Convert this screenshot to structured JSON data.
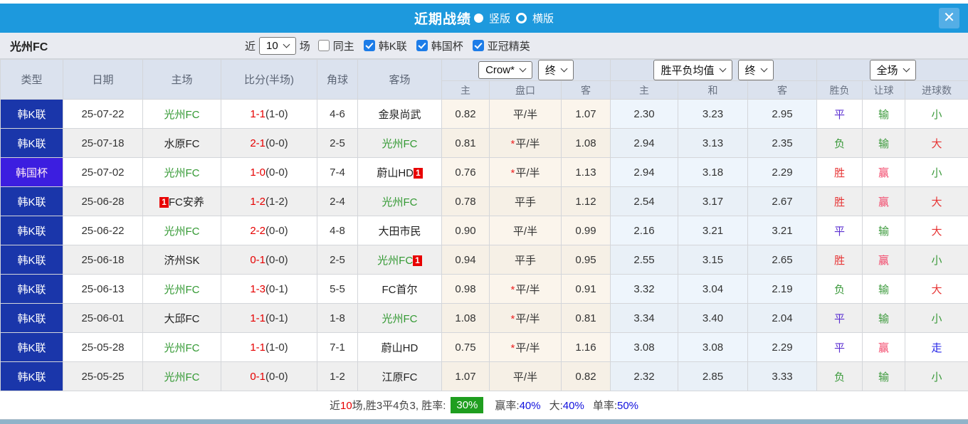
{
  "title_bar": {
    "title": "近期战绩",
    "vertical_label": "竖版",
    "horizontal_label": "横版",
    "close_glyph": "✕"
  },
  "filter_bar": {
    "team": "光州FC",
    "near_label": "近",
    "count_value": "10",
    "games_label": "场",
    "same_home_label": "同主",
    "leagues": [
      "韩K联",
      "韩国杯",
      "亚冠精英"
    ]
  },
  "table": {
    "headers_main": [
      "类型",
      "日期",
      "主场",
      "比分(半场)",
      "角球",
      "客场"
    ],
    "sub": [
      "主",
      "盘口",
      "客",
      "主",
      "和",
      "客",
      "胜负",
      "让球",
      "进球数"
    ],
    "dropdowns": {
      "asia_company": "Crow*",
      "asia_time": "终",
      "europe_company": "胜平负均值",
      "europe_time": "终",
      "scope": "全场"
    },
    "star_glyph": "*",
    "rows": [
      {
        "type": "韩K联",
        "cup": false,
        "date": "25-07-22",
        "home": {
          "name": "光州FC",
          "self": true
        },
        "score": "1-1",
        "half": "(1-0)",
        "corner": "4-6",
        "away": {
          "name": "金泉尚武",
          "self": false
        },
        "asia_home": "0.82",
        "star": false,
        "handicap": "平/半",
        "asia_away": "1.07",
        "eu_home": "2.30",
        "eu_draw": "3.23",
        "eu_away": "2.95",
        "spf": {
          "t": "平",
          "c": "purple"
        },
        "rq": {
          "t": "输",
          "c": "green"
        },
        "jq": {
          "t": "小",
          "c": "green"
        }
      },
      {
        "type": "韩K联",
        "cup": false,
        "date": "25-07-18",
        "home": {
          "name": "水原FC",
          "self": false
        },
        "score": "2-1",
        "half": "(0-0)",
        "corner": "2-5",
        "away": {
          "name": "光州FC",
          "self": true
        },
        "asia_home": "0.81",
        "star": true,
        "handicap": "平/半",
        "asia_away": "1.08",
        "eu_home": "2.94",
        "eu_draw": "3.13",
        "eu_away": "2.35",
        "spf": {
          "t": "负",
          "c": "green"
        },
        "rq": {
          "t": "输",
          "c": "green"
        },
        "jq": {
          "t": "大",
          "c": "red"
        }
      },
      {
        "type": "韩国杯",
        "cup": true,
        "date": "25-07-02",
        "home": {
          "name": "光州FC",
          "self": true
        },
        "score": "1-0",
        "half": "(0-0)",
        "corner": "7-4",
        "away": {
          "name": "蔚山HD",
          "self": false,
          "badge": "1",
          "badge_pos": "after"
        },
        "asia_home": "0.76",
        "star": true,
        "handicap": "平/半",
        "asia_away": "1.13",
        "eu_home": "2.94",
        "eu_draw": "3.18",
        "eu_away": "2.29",
        "spf": {
          "t": "胜",
          "c": "red"
        },
        "rq": {
          "t": "赢",
          "c": "pink"
        },
        "jq": {
          "t": "小",
          "c": "green"
        }
      },
      {
        "type": "韩K联",
        "cup": false,
        "date": "25-06-28",
        "home": {
          "name": "FC安养",
          "self": false,
          "badge": "1",
          "badge_pos": "before"
        },
        "score": "1-2",
        "half": "(1-2)",
        "corner": "2-4",
        "away": {
          "name": "光州FC",
          "self": true
        },
        "asia_home": "0.78",
        "star": false,
        "handicap": "平手",
        "asia_away": "1.12",
        "eu_home": "2.54",
        "eu_draw": "3.17",
        "eu_away": "2.67",
        "spf": {
          "t": "胜",
          "c": "red"
        },
        "rq": {
          "t": "赢",
          "c": "pink"
        },
        "jq": {
          "t": "大",
          "c": "red"
        }
      },
      {
        "type": "韩K联",
        "cup": false,
        "date": "25-06-22",
        "home": {
          "name": "光州FC",
          "self": true
        },
        "score": "2-2",
        "half": "(0-0)",
        "corner": "4-8",
        "away": {
          "name": "大田市民",
          "self": false
        },
        "asia_home": "0.90",
        "star": false,
        "handicap": "平/半",
        "asia_away": "0.99",
        "eu_home": "2.16",
        "eu_draw": "3.21",
        "eu_away": "3.21",
        "spf": {
          "t": "平",
          "c": "purple"
        },
        "rq": {
          "t": "输",
          "c": "green"
        },
        "jq": {
          "t": "大",
          "c": "red"
        }
      },
      {
        "type": "韩K联",
        "cup": false,
        "date": "25-06-18",
        "home": {
          "name": "济州SK",
          "self": false
        },
        "score": "0-1",
        "half": "(0-0)",
        "corner": "2-5",
        "away": {
          "name": "光州FC",
          "self": true,
          "badge": "1",
          "badge_pos": "after"
        },
        "asia_home": "0.94",
        "star": false,
        "handicap": "平手",
        "asia_away": "0.95",
        "eu_home": "2.55",
        "eu_draw": "3.15",
        "eu_away": "2.65",
        "spf": {
          "t": "胜",
          "c": "red"
        },
        "rq": {
          "t": "赢",
          "c": "pink"
        },
        "jq": {
          "t": "小",
          "c": "green"
        }
      },
      {
        "type": "韩K联",
        "cup": false,
        "date": "25-06-13",
        "home": {
          "name": "光州FC",
          "self": true
        },
        "score": "1-3",
        "half": "(0-1)",
        "corner": "5-5",
        "away": {
          "name": "FC首尔",
          "self": false
        },
        "asia_home": "0.98",
        "star": true,
        "handicap": "平/半",
        "asia_away": "0.91",
        "eu_home": "3.32",
        "eu_draw": "3.04",
        "eu_away": "2.19",
        "spf": {
          "t": "负",
          "c": "green"
        },
        "rq": {
          "t": "输",
          "c": "green"
        },
        "jq": {
          "t": "大",
          "c": "red"
        }
      },
      {
        "type": "韩K联",
        "cup": false,
        "date": "25-06-01",
        "home": {
          "name": "大邱FC",
          "self": false
        },
        "score": "1-1",
        "half": "(0-1)",
        "corner": "1-8",
        "away": {
          "name": "光州FC",
          "self": true
        },
        "asia_home": "1.08",
        "star": true,
        "handicap": "平/半",
        "asia_away": "0.81",
        "eu_home": "3.34",
        "eu_draw": "3.40",
        "eu_away": "2.04",
        "spf": {
          "t": "平",
          "c": "purple"
        },
        "rq": {
          "t": "输",
          "c": "green"
        },
        "jq": {
          "t": "小",
          "c": "green"
        }
      },
      {
        "type": "韩K联",
        "cup": false,
        "date": "25-05-28",
        "home": {
          "name": "光州FC",
          "self": true
        },
        "score": "1-1",
        "half": "(1-0)",
        "corner": "7-1",
        "away": {
          "name": "蔚山HD",
          "self": false
        },
        "asia_home": "0.75",
        "star": true,
        "handicap": "平/半",
        "asia_away": "1.16",
        "eu_home": "3.08",
        "eu_draw": "3.08",
        "eu_away": "2.29",
        "spf": {
          "t": "平",
          "c": "purple"
        },
        "rq": {
          "t": "赢",
          "c": "pink"
        },
        "jq": {
          "t": "走",
          "c": "blue"
        }
      },
      {
        "type": "韩K联",
        "cup": false,
        "date": "25-05-25",
        "home": {
          "name": "光州FC",
          "self": true
        },
        "score": "0-1",
        "half": "(0-0)",
        "corner": "1-2",
        "away": {
          "name": "江原FC",
          "self": false
        },
        "asia_home": "1.07",
        "star": false,
        "handicap": "平/半",
        "asia_away": "0.82",
        "eu_home": "2.32",
        "eu_draw": "2.85",
        "eu_away": "3.33",
        "spf": {
          "t": "负",
          "c": "green"
        },
        "rq": {
          "t": "输",
          "c": "green"
        },
        "jq": {
          "t": "小",
          "c": "green"
        }
      }
    ]
  },
  "footer": {
    "seg1": "近",
    "matches": "10",
    "seg2": "场,胜3平4负3, 胜率:",
    "rate": "30%",
    "pairs": [
      {
        "label": "赢率:",
        "value": "40%"
      },
      {
        "label": "大:",
        "value": "40%"
      },
      {
        "label": "单率:",
        "value": "50%"
      }
    ]
  },
  "colors": {
    "accent_blue": "#1d99dd",
    "league_navy": "#1a36aa",
    "cup_indigo": "#3c1ee0",
    "self_team_green": "#339933",
    "score_red": "#e60000",
    "rate_badge_green": "#1f9e1f",
    "stat_blue": "#1111dd"
  }
}
